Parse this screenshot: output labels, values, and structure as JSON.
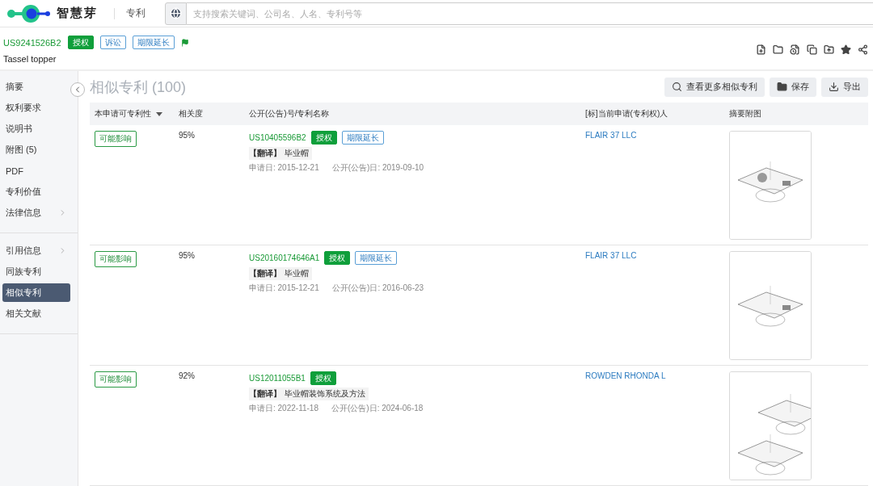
{
  "header": {
    "brand": "智慧芽",
    "section": "专利",
    "search": {
      "placeholder": "支持搜索关键词、公司名、人名、专利号等"
    }
  },
  "patent": {
    "number": "US9241526B2",
    "title": "Tassel topper",
    "tags": [
      {
        "label": "授权",
        "kind": "status"
      },
      {
        "label": "诉讼",
        "kind": "info"
      },
      {
        "label": "期限延长",
        "kind": "info"
      }
    ]
  },
  "sidebar": {
    "groups": [
      [
        {
          "label": "摘要",
          "selected": false,
          "expandable": false
        },
        {
          "label": "权利要求",
          "selected": false,
          "expandable": false
        },
        {
          "label": "说明书",
          "selected": false,
          "expandable": false
        },
        {
          "label": "附图 (5)",
          "selected": false,
          "expandable": false
        },
        {
          "label": "PDF",
          "selected": false,
          "expandable": false
        },
        {
          "label": "专利价值",
          "selected": false,
          "expandable": false
        },
        {
          "label": "法律信息",
          "selected": false,
          "expandable": true
        }
      ],
      [
        {
          "label": "引用信息",
          "selected": false,
          "expandable": true
        },
        {
          "label": "同族专利",
          "selected": false,
          "expandable": false
        },
        {
          "label": "相似专利",
          "selected": true,
          "expandable": false
        },
        {
          "label": "相关文献",
          "selected": false,
          "expandable": false
        }
      ]
    ]
  },
  "page_title": {
    "label": "相似专利",
    "count": "(100)"
  },
  "actions": [
    {
      "label": "查看更多相似专利",
      "kind": "search"
    },
    {
      "label": "保存",
      "kind": "folder"
    },
    {
      "label": "导出",
      "kind": "export"
    }
  ],
  "table": {
    "columns": [
      "本申请可专利性",
      "相关度",
      "公开(公告)号/专利名称",
      "[标]当前申请(专利权)人",
      "摘要附图"
    ],
    "rows": [
      {
        "patentability": "可能影响",
        "relevance": "95%",
        "number": "US10405596B2",
        "tags": [
          {
            "label": "授权",
            "kind": "status"
          },
          {
            "label": "期限延长",
            "kind": "info"
          }
        ],
        "translate_label": "【翻译】",
        "name": "毕业帽",
        "filing_date": "申请日: 2015-12-21",
        "publication_date": "公开(公告)日: 2019-09-10",
        "assignee": "FLAIR 37 LLC",
        "figure": {
          "kind": "picture"
        }
      },
      {
        "patentability": "可能影响",
        "relevance": "95%",
        "number": "US20160174646A1",
        "tags": [
          {
            "label": "授权",
            "kind": "status"
          },
          {
            "label": "期限延长",
            "kind": "info"
          }
        ],
        "translate_label": "【翻译】",
        "name": "毕业帽",
        "filing_date": "申请日: 2015-12-21",
        "publication_date": "公开(公告)日: 2016-06-23",
        "assignee": "FLAIR 37 LLC",
        "figure": {
          "kind": "picture"
        }
      },
      {
        "patentability": "可能影响",
        "relevance": "92%",
        "number": "US12011055B1",
        "tags": [
          {
            "label": "授权",
            "kind": "status"
          }
        ],
        "translate_label": "【翻译】",
        "name": "毕业帽装饰系统及方法",
        "filing_date": "申请日: 2022-11-18",
        "publication_date": "公开(公告)日: 2024-06-18",
        "assignee": "ROWDEN RHONDA L",
        "figure": {
          "kind": "picture"
        }
      }
    ]
  }
}
